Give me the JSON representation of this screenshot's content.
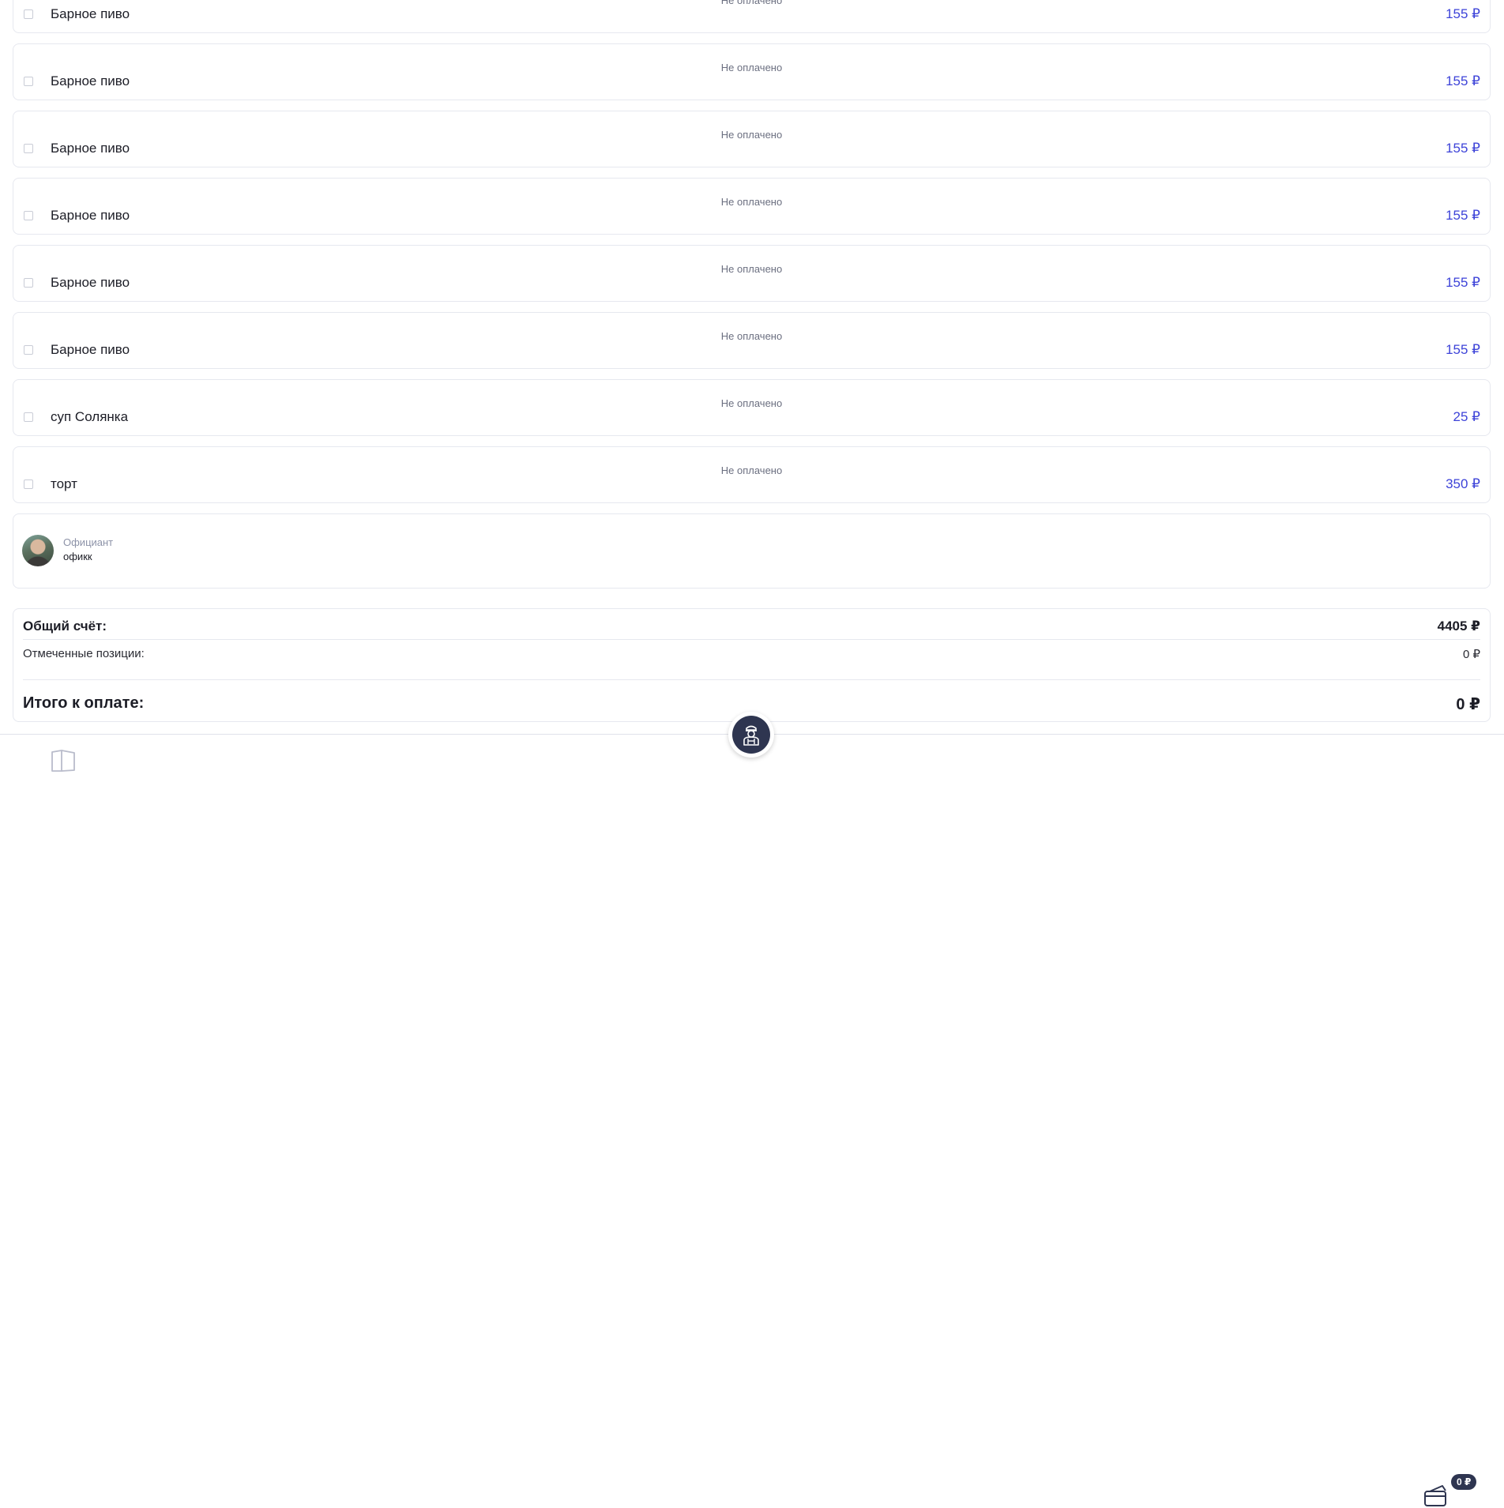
{
  "order_items": [
    {
      "name": "Барное пиво",
      "status": "Не оплачено",
      "price": "155 ₽"
    },
    {
      "name": "Барное пиво",
      "status": "Не оплачено",
      "price": "155 ₽"
    },
    {
      "name": "Барное пиво",
      "status": "Не оплачено",
      "price": "155 ₽"
    },
    {
      "name": "Барное пиво",
      "status": "Не оплачено",
      "price": "155 ₽"
    },
    {
      "name": "Барное пиво",
      "status": "Не оплачено",
      "price": "155 ₽"
    },
    {
      "name": "Барное пиво",
      "status": "Не оплачено",
      "price": "155 ₽"
    },
    {
      "name": "суп Солянка",
      "status": "Не оплачено",
      "price": "25 ₽"
    },
    {
      "name": "торт",
      "status": "Не оплачено",
      "price": "350 ₽"
    }
  ],
  "waiter": {
    "role": "Официант",
    "name": "офикк"
  },
  "totals": {
    "total_label": "Общий счёт:",
    "total_value": "4405 ₽",
    "selected_label": "Отмеченные позиции:",
    "selected_value": "0 ₽",
    "to_pay_label": "Итого к оплате:",
    "to_pay_value": "0 ₽"
  },
  "bottom_nav": {
    "menu_icon": "book-icon",
    "call_waiter_icon": "waiter-icon",
    "cart_icon": "card-icon",
    "cart_badge": "0 ₽"
  },
  "colors": {
    "accent": "#3d43d8",
    "dark": "#2e3550",
    "muted": "#6b6f80"
  }
}
